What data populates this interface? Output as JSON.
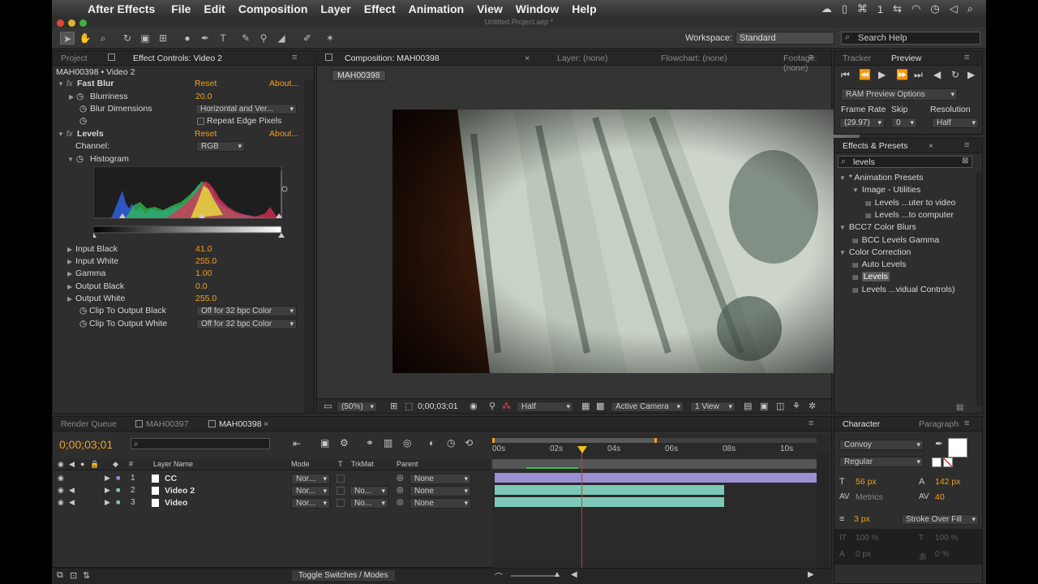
{
  "menubar": {
    "app": "After Effects",
    "items": [
      "File",
      "Edit",
      "Composition",
      "Layer",
      "Effect",
      "Animation",
      "View",
      "Window",
      "Help"
    ]
  },
  "window_title": "Untitled Project.aep *",
  "toolbar": {
    "workspace_label": "Workspace:",
    "workspace_value": "Standard",
    "search_placeholder": "Search Help"
  },
  "left_panel": {
    "tab_project": "Project",
    "tab_effect_controls": "Effect Controls: Video 2",
    "subtitle": "MAH00398 • Video 2",
    "fast_blur": {
      "name": "Fast Blur",
      "reset": "Reset",
      "about": "About...",
      "blurriness_label": "Blurriness",
      "blurriness_value": "20.0",
      "blur_dimensions_label": "Blur Dimensions",
      "blur_dimensions_value": "Horizontal and Ver...",
      "repeat_edge": "Repeat Edge Pixels"
    },
    "levels": {
      "name": "Levels",
      "reset": "Reset",
      "about": "About...",
      "channel_label": "Channel:",
      "channel_value": "RGB",
      "histogram_label": "Histogram",
      "input_black_label": "Input Black",
      "input_black": "41.0",
      "input_white_label": "Input White",
      "input_white": "255.0",
      "gamma_label": "Gamma",
      "gamma": "1.00",
      "output_black_label": "Output Black",
      "output_black": "0.0",
      "output_white_label": "Output White",
      "output_white": "255.0",
      "clip_black_label": "Clip To Output Black",
      "clip_black_value": "Off for 32 bpc Color",
      "clip_white_label": "Clip To Output White",
      "clip_white_value": "Off for 32 bpc Color"
    }
  },
  "comp_panel": {
    "tab_comp": "Composition: MAH00398",
    "tab_layer": "Layer: (none)",
    "tab_flowchart": "Flowchart: (none)",
    "tab_footage": "Footage: (none)",
    "comp_name": "MAH00398",
    "zoom": "(50%)",
    "timecode": "0;00;03;01",
    "resolution": "Half",
    "camera": "Active Camera",
    "views": "1 View"
  },
  "preview_panel": {
    "tab_tracker": "Tracker",
    "tab_preview": "Preview",
    "ram_options": "RAM Preview Options",
    "frame_rate_label": "Frame Rate",
    "skip_label": "Skip",
    "resolution_label": "Resolution",
    "frame_rate": "(29.97)",
    "skip": "0",
    "resolution": "Half"
  },
  "effects_panel": {
    "tab": "Effects & Presets",
    "search_value": "levels",
    "tree": [
      {
        "label": "* Animation Presets",
        "indent": 0,
        "kind": "folder"
      },
      {
        "label": "Image - Utilities",
        "indent": 1,
        "kind": "folder"
      },
      {
        "label": "Levels ...uter to video",
        "indent": 2,
        "kind": "preset"
      },
      {
        "label": "Levels ...to computer",
        "indent": 2,
        "kind": "preset"
      },
      {
        "label": "BCC7 Color Blurs",
        "indent": 0,
        "kind": "folder"
      },
      {
        "label": "BCC Levels Gamma",
        "indent": 1,
        "kind": "effect"
      },
      {
        "label": "Color Correction",
        "indent": 0,
        "kind": "folder"
      },
      {
        "label": "Auto Levels",
        "indent": 1,
        "kind": "effect"
      },
      {
        "label": "Levels",
        "indent": 1,
        "kind": "effect",
        "selected": true
      },
      {
        "label": "Levels ...vidual Controls)",
        "indent": 1,
        "kind": "effect"
      }
    ]
  },
  "timeline": {
    "tabs": [
      "Render Queue",
      "MAH00397",
      "MAH00398"
    ],
    "timecode": "0;00;03;01",
    "col_layer_name": "Layer Name",
    "col_mode": "Mode",
    "col_t": "T",
    "col_trkmat": "TrkMat",
    "col_parent": "Parent",
    "col_num": "#",
    "ruler": [
      "00s",
      "02s",
      "04s",
      "06s",
      "08s",
      "10s"
    ],
    "layers": [
      {
        "num": "1",
        "name": "CC",
        "mode": "Nor...",
        "trkmat": "",
        "parent": "None"
      },
      {
        "num": "2",
        "name": "Video 2",
        "mode": "Nor...",
        "trkmat": "No...",
        "parent": "None"
      },
      {
        "num": "3",
        "name": "Video",
        "mode": "Nor...",
        "trkmat": "No...",
        "parent": "None"
      }
    ],
    "toggle_label": "Toggle Switches / Modes"
  },
  "character_panel": {
    "tab_character": "Character",
    "tab_paragraph": "Paragraph",
    "font": "Convoy",
    "style": "Regular",
    "size": "56 px",
    "leading": "142 px",
    "kerning": "Metrics",
    "tracking": "40",
    "stroke_width": "3 px",
    "stroke_type": "Stroke Over Fill",
    "vscale": "100 %",
    "hscale": "100 %",
    "baseline": "0 px",
    "tsume": "0 %"
  },
  "colors": {
    "accent_orange": "#f0a020",
    "label_lavender": "#9a8fd0",
    "label_teal": "#7ec8b8",
    "playhead": "#e03030"
  }
}
